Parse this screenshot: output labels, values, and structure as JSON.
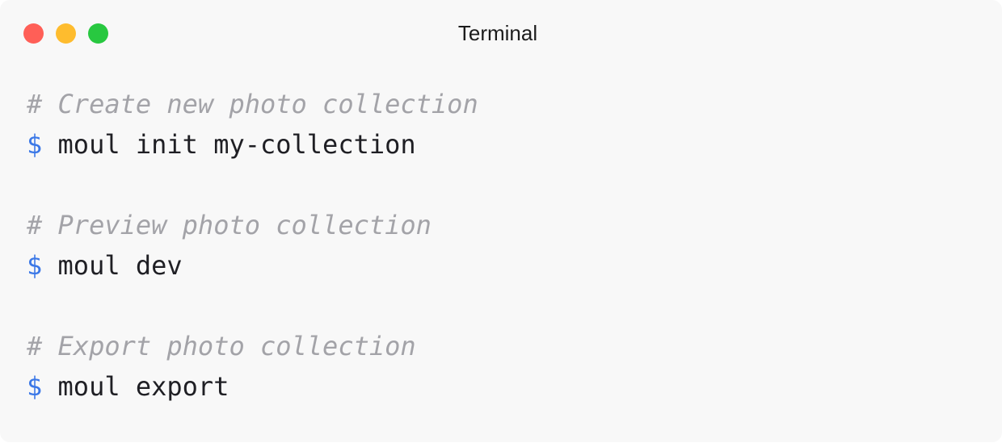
{
  "window": {
    "title": "Terminal",
    "controls": {
      "close_color": "#ff5f57",
      "minimize_color": "#febc2e",
      "zoom_color": "#28c840"
    }
  },
  "terminal": {
    "prompt_symbol": "$",
    "colors": {
      "prompt": "#3b78e7",
      "comment": "#a3a3a8",
      "command": "#1f1f24",
      "background": "#f8f8f8"
    },
    "blocks": [
      {
        "comment": "# Create new photo collection",
        "command": "moul init my-collection"
      },
      {
        "comment": "# Preview photo collection",
        "command": "moul dev"
      },
      {
        "comment": "# Export photo collection",
        "command": "moul export"
      }
    ]
  }
}
